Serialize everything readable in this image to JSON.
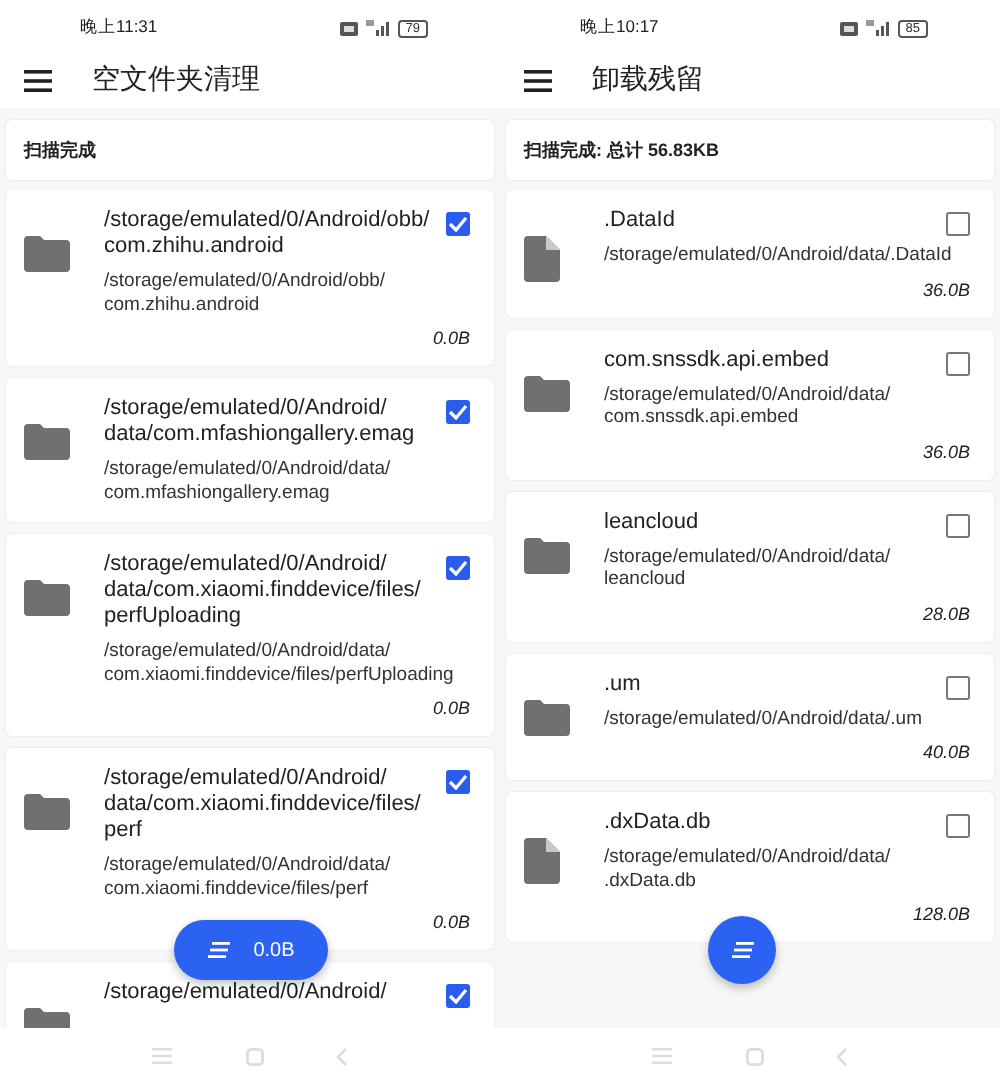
{
  "screens": [
    {
      "status_bar": {
        "time": "晚上11:31",
        "battery": "79"
      },
      "title": "空文件夹清理",
      "summary": "扫描完成",
      "items": [
        {
          "kind": "folder",
          "name": "/storage/emulated/0/Android/obb/com.zhihu.android",
          "path": "/storage/emulated/0/Android/obb/com.zhihu.android",
          "size": "0.0B",
          "checked": true
        },
        {
          "kind": "folder",
          "name": "/storage/emulated/0/Android/data/com.mfashiongallery.emag",
          "path": "/storage/emulated/0/Android/data/com.mfashiongallery.emag",
          "checked": true
        },
        {
          "kind": "folder",
          "name": "/storage/emulated/0/Android/data/com.xiaomi.finddevice/files/perfUploading",
          "path": "/storage/emulated/0/Android/data/com.xiaomi.finddevice/files/perfUploading",
          "size": "0.0B",
          "checked": true
        },
        {
          "kind": "folder",
          "name": "/storage/emulated/0/Android/data/com.xiaomi.finddevice/files/perf",
          "path": "/storage/emulated/0/Android/data/com.xiaomi.finddevice/files/perf",
          "size": "0.0B",
          "checked": true
        },
        {
          "kind": "folder",
          "name": "/storage/emulated/0/Android/",
          "checked": true
        }
      ],
      "fab": {
        "kind": "pill",
        "label": "0.0B"
      }
    },
    {
      "status_bar": {
        "time": "晚上10:17",
        "battery": "85"
      },
      "title": "卸载残留",
      "summary": "扫描完成: 总计 56.83KB",
      "items": [
        {
          "kind": "file",
          "name": ".DataId",
          "path": "/storage/emulated/0/Android/data/.DataId",
          "size": "36.0B",
          "checked": false
        },
        {
          "kind": "folder",
          "name": "com.snssdk.api.embed",
          "path": "/storage/emulated/0/Android/data/com.snssdk.api.embed",
          "size": "36.0B",
          "checked": false
        },
        {
          "kind": "folder",
          "name": "leancloud",
          "path": "/storage/emulated/0/Android/data/leancloud",
          "size": "28.0B",
          "checked": false
        },
        {
          "kind": "folder",
          "name": ".um",
          "path": "/storage/emulated/0/Android/data/.um",
          "size": "40.0B",
          "checked": false
        },
        {
          "kind": "file",
          "name": ".dxData.db",
          "path": "/storage/emulated/0/Android/data/.dxData.db",
          "size": "128.0B",
          "checked": false
        }
      ],
      "fab": {
        "kind": "round"
      }
    }
  ]
}
